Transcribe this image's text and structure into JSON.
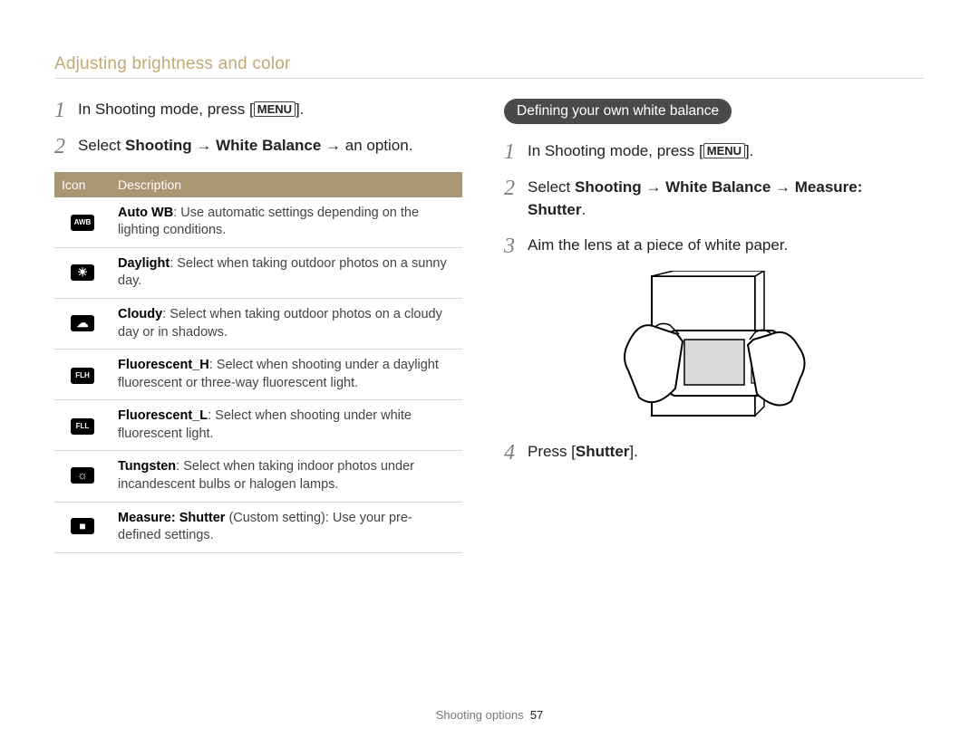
{
  "section_title": "Adjusting brightness and color",
  "left": {
    "steps": [
      {
        "num": "1",
        "pre": "In Shooting mode, press [",
        "btn": "MENU",
        "post": "]."
      },
      {
        "num": "2",
        "pre": "Select ",
        "b1": "Shooting",
        "arrow1": " → ",
        "b2": "White Balance",
        "arrow2": " → ",
        "post": "an option."
      }
    ],
    "table": {
      "head_icon": "Icon",
      "head_desc": "Description",
      "rows": [
        {
          "icon_label": "AWB",
          "b": "Auto WB",
          "rest": ": Use automatic settings depending on the lighting conditions."
        },
        {
          "icon_label": "☀",
          "b": "Daylight",
          "rest": ": Select when taking outdoor photos on a sunny day."
        },
        {
          "icon_label": "☁",
          "b": "Cloudy",
          "rest": ": Select when taking outdoor photos on a cloudy day or in shadows."
        },
        {
          "icon_label": "FLH",
          "b": "Fluorescent_H",
          "rest": ": Select when shooting under a daylight fluorescent or three-way fluorescent light."
        },
        {
          "icon_label": "FLL",
          "b": "Fluorescent_L",
          "rest": ": Select when shooting under white fluorescent light."
        },
        {
          "icon_label": "☼",
          "b": "Tungsten",
          "rest": ": Select when taking indoor photos under incandescent bulbs or halogen lamps."
        },
        {
          "icon_label": "■",
          "b": "Measure: Shutter",
          "rest": " (Custom setting): Use your pre-defined settings."
        }
      ]
    }
  },
  "right": {
    "badge": "Defining your own white balance",
    "steps": [
      {
        "num": "1",
        "pre": "In Shooting mode, press [",
        "btn": "MENU",
        "post": "]."
      },
      {
        "num": "2",
        "pre": "Select ",
        "b1": "Shooting",
        "arrow1": " → ",
        "b2": "White Balance",
        "arrow2": " → ",
        "b3": "Measure: Shutter",
        "post2": "."
      },
      {
        "num": "3",
        "pre": "Aim the lens at a piece of white paper."
      },
      {
        "num": "4",
        "pre": "Press [",
        "b1": "Shutter",
        "post": "]."
      }
    ]
  },
  "footer": {
    "label": "Shooting options",
    "page": "57"
  }
}
